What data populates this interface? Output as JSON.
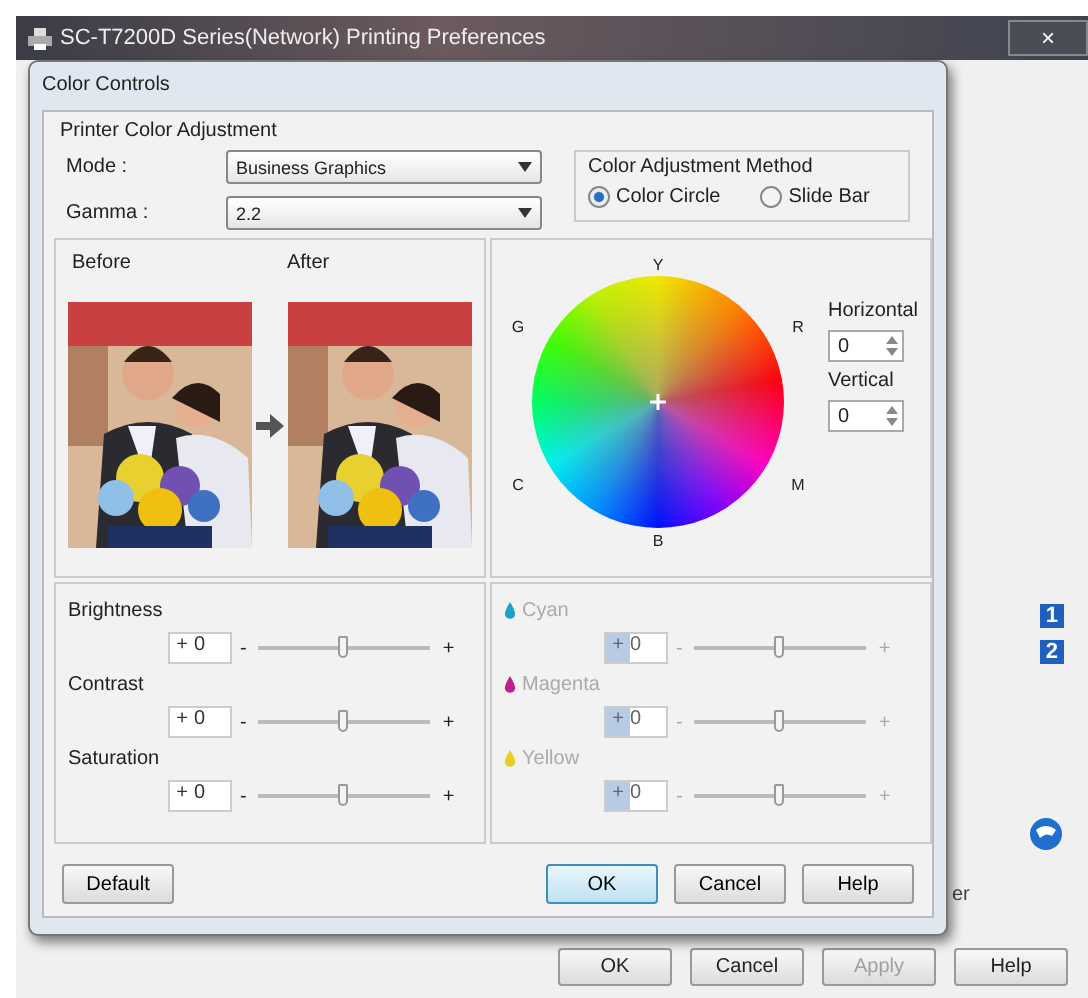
{
  "window": {
    "title": "SC-T7200D Series(Network) Printing Preferences",
    "close": "×"
  },
  "background": {
    "badges": [
      "1",
      "2"
    ],
    "fragment": "er"
  },
  "buttons": [
    {
      "label": "OK",
      "disabled": false
    },
    {
      "label": "Cancel",
      "disabled": false
    },
    {
      "label": "Apply",
      "disabled": true
    },
    {
      "label": "Help",
      "disabled": false
    }
  ],
  "dialog": {
    "title": "Color Controls",
    "group_title": "Printer Color Adjustment",
    "mode": {
      "label": "Mode :",
      "value": "Business Graphics"
    },
    "gamma": {
      "label": "Gamma :",
      "value": "2.2"
    },
    "method": {
      "title": "Color Adjustment Method",
      "options": [
        {
          "label": "Color Circle",
          "selected": true
        },
        {
          "label": "Slide Bar",
          "selected": false
        }
      ]
    },
    "preview": {
      "before": "Before",
      "after": "After"
    },
    "wheel": {
      "labels": {
        "top": "Y",
        "upper_left": "G",
        "upper_right": "R",
        "lower_left": "C",
        "lower_right": "M",
        "bottom": "B"
      },
      "horizontal": {
        "label": "Horizontal",
        "value": "0"
      },
      "vertical": {
        "label": "Vertical",
        "value": "0"
      }
    },
    "sliders": [
      {
        "name": "Brightness",
        "sign": "+",
        "value": "0",
        "level": 0.5,
        "minus": "-",
        "plus": "+",
        "disabled": false
      },
      {
        "name": "Contrast",
        "sign": "+",
        "value": "0",
        "level": 0.5,
        "minus": "-",
        "plus": "+",
        "disabled": false
      },
      {
        "name": "Saturation",
        "sign": "+",
        "value": "0",
        "level": 0.5,
        "minus": "-",
        "plus": "+",
        "disabled": false
      }
    ],
    "inks": [
      {
        "name": "Cyan",
        "color": "#1aa3c8",
        "sign": "+",
        "value": "0",
        "level": 0.5,
        "minus": "-",
        "plus": "+",
        "disabled": true
      },
      {
        "name": "Magenta",
        "color": "#c0208a",
        "sign": "+",
        "value": "0",
        "level": 0.5,
        "minus": "-",
        "plus": "+",
        "disabled": true
      },
      {
        "name": "Yellow",
        "color": "#e8d020",
        "sign": "+",
        "value": "0",
        "level": 0.5,
        "minus": "-",
        "plus": "+",
        "disabled": true
      }
    ],
    "buttons": [
      {
        "label": "Default",
        "default": false
      },
      {
        "label": "OK",
        "default": true
      },
      {
        "label": "Cancel",
        "default": false
      },
      {
        "label": "Help",
        "default": false
      }
    ]
  }
}
